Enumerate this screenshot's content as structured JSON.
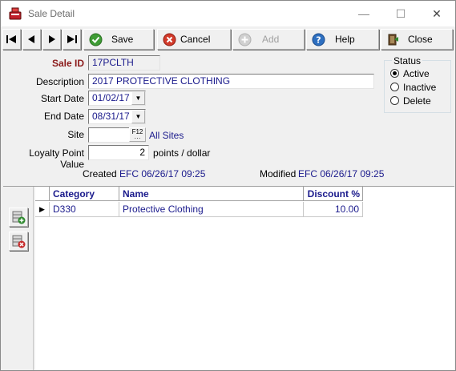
{
  "window": {
    "title": "Sale Detail",
    "controls": {
      "minimize": "—",
      "maximize": "☐",
      "close": "✕"
    }
  },
  "toolbar": {
    "nav": [
      "first-record-icon",
      "prev-record-icon",
      "next-record-icon",
      "last-record-icon"
    ],
    "save_label": "Save",
    "cancel_label": "Cancel",
    "add_label": "Add",
    "help_label": "Help",
    "close_label": "Close"
  },
  "form": {
    "sale_id_label": "Sale ID",
    "sale_id": "17PCLTH",
    "description_label": "Description",
    "description": "2017 PROTECTIVE CLOTHING",
    "start_date_label": "Start Date",
    "start_date": "01/02/17",
    "end_date_label": "End Date",
    "end_date": "08/31/17",
    "site_label": "Site",
    "site_value": "",
    "site_lookup": "F12",
    "site_text": "All Sites",
    "loyalty_label": "Loyalty Point Value",
    "loyalty_value": "2",
    "loyalty_unit": "points / dollar",
    "created_label": "Created",
    "created_value": "EFC 06/26/17 09:25",
    "modified_label": "Modified",
    "modified_value": "EFC 06/26/17 09:25"
  },
  "status": {
    "title": "Status",
    "options": [
      "Active",
      "Inactive",
      "Delete"
    ],
    "selected": "Active"
  },
  "grid": {
    "columns": [
      "Category",
      "Name",
      "Discount %"
    ],
    "rows": [
      {
        "category": "D330",
        "name": "Protective Clothing",
        "discount": "10.00"
      }
    ]
  },
  "colors": {
    "accent": "#1a1a8c",
    "label_red": "#8b1a1a"
  }
}
